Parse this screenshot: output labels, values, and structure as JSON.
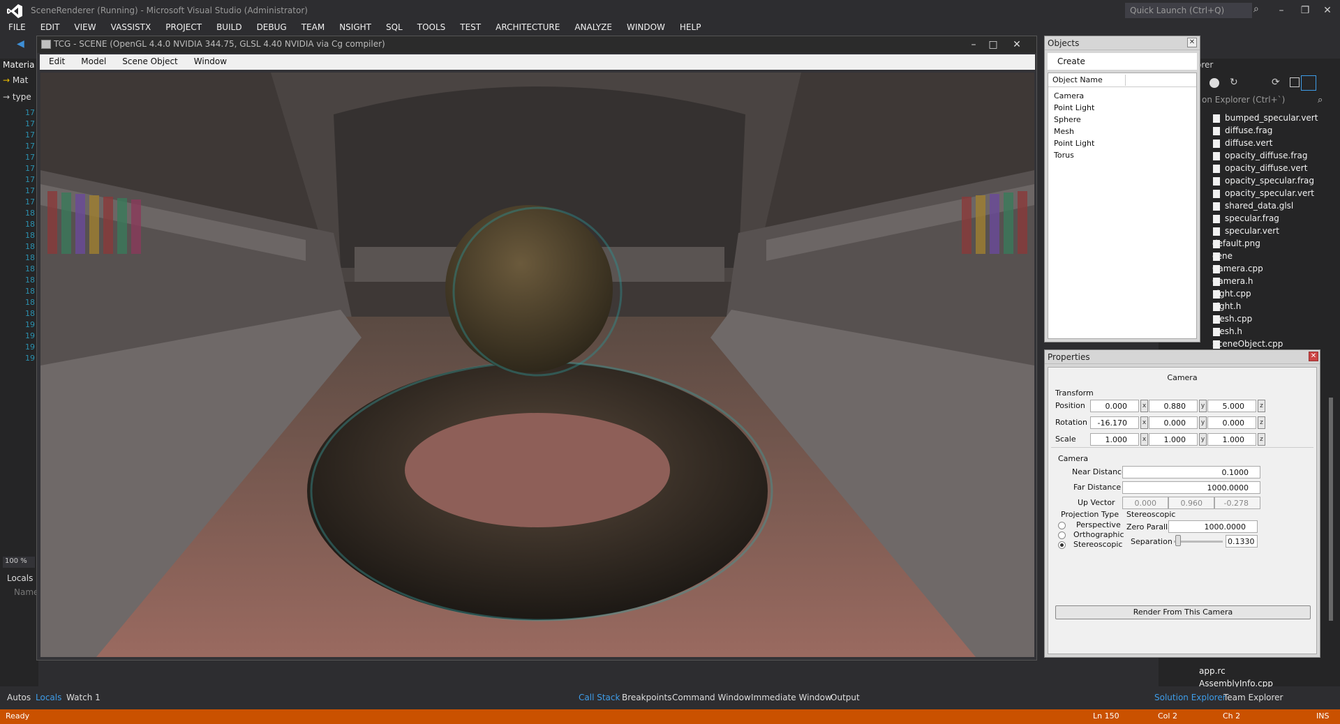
{
  "window_title": "SceneRenderer (Running) - Microsoft Visual Studio (Administrator)",
  "quick_launch_placeholder": "Quick Launch (Ctrl+Q)",
  "menu": [
    "FILE",
    "EDIT",
    "VIEW",
    "VASSISTX",
    "PROJECT",
    "BUILD",
    "DEBUG",
    "TEAM",
    "NSIGHT",
    "SQL",
    "TOOLS",
    "TEST",
    "ARCHITECTURE",
    "ANALYZE",
    "WINDOW",
    "HELP"
  ],
  "left_panel": {
    "tab": "Materia",
    "row1": "Mat",
    "row2": "type",
    "line_numbers": [
      "17",
      "17",
      "17",
      "17",
      "17",
      "17",
      "17",
      "17",
      "17",
      "18",
      "18",
      "18",
      "18",
      "18",
      "18",
      "18",
      "18",
      "18",
      "18",
      "19",
      "19",
      "19",
      "19"
    ],
    "zoom": "100 %",
    "locals_title": "Locals",
    "name_col": "Name"
  },
  "solution_explorer": {
    "title": "orer",
    "search": "on Explorer (Ctrl+`)",
    "items": [
      "bumped_specular.vert",
      "diffuse.frag",
      "diffuse.vert",
      "opacity_diffuse.frag",
      "opacity_diffuse.vert",
      "opacity_specular.frag",
      "opacity_specular.vert",
      "shared_data.glsl",
      "specular.frag",
      "specular.vert",
      "default.png",
      "cene",
      "Camera.cpp",
      "Camera.h",
      "Light.cpp",
      "Light.h",
      "Mesh.cpp",
      "Mesh.h",
      "SceneObject.cpp"
    ],
    "bottom_items": [
      "app.rc",
      "AssemblyInfo.cpp"
    ]
  },
  "tcg": {
    "title": "TCG - SCENE (OpenGL 4.4.0 NVIDIA 344.75, GLSL 4.40 NVIDIA via Cg compiler)",
    "menu": [
      "Edit",
      "Model",
      "Scene Object",
      "Window"
    ]
  },
  "objects": {
    "title": "Objects",
    "create": "Create",
    "header": "Object Name",
    "items": [
      "Camera",
      "Point Light",
      "Sphere",
      "Mesh",
      "Point Light",
      "Torus"
    ]
  },
  "properties": {
    "title": "Properties",
    "object": "Camera",
    "transform_label": "Transform",
    "position_label": "Position",
    "position": [
      "0.000",
      "0.880",
      "5.000"
    ],
    "rotation_label": "Rotation",
    "rotation": [
      "-16.170",
      "0.000",
      "0.000"
    ],
    "scale_label": "Scale",
    "scale": [
      "1.000",
      "1.000",
      "1.000"
    ],
    "axes": [
      "x",
      "y",
      "z"
    ],
    "camera_label": "Camera",
    "near_label": "Near Distance",
    "near": "0.1000",
    "far_label": "Far Distance",
    "far": "1000.0000",
    "up_label": "Up Vector",
    "up": [
      "0.000",
      "0.960",
      "-0.278"
    ],
    "projection_label": "Projection Type",
    "projections": [
      "Perspective",
      "Orthographic",
      "Stereoscopic"
    ],
    "selected_projection": "Stereoscopic",
    "stereo_label": "Stereoscopic",
    "zero_parallax_label": "Zero Parallax",
    "zero_parallax": "1000.0000",
    "separation_label": "Separation",
    "separation": "0.1330",
    "render_button": "Render From This Camera"
  },
  "bottom_tabs_left": [
    "Autos",
    "Locals",
    "Watch 1"
  ],
  "bottom_tabs_mid": [
    "Call Stack",
    "Breakpoints",
    "Command Window",
    "Immediate Window",
    "Output"
  ],
  "bottom_tabs_right": [
    "Solution Explorer",
    "Team Explorer"
  ],
  "status": {
    "ready": "Ready",
    "ln": "Ln 150",
    "col": "Col 2",
    "ch": "Ch 2",
    "ins": "INS"
  },
  "colors": {
    "accent": "#ca5100",
    "link": "#3e9ce8"
  }
}
